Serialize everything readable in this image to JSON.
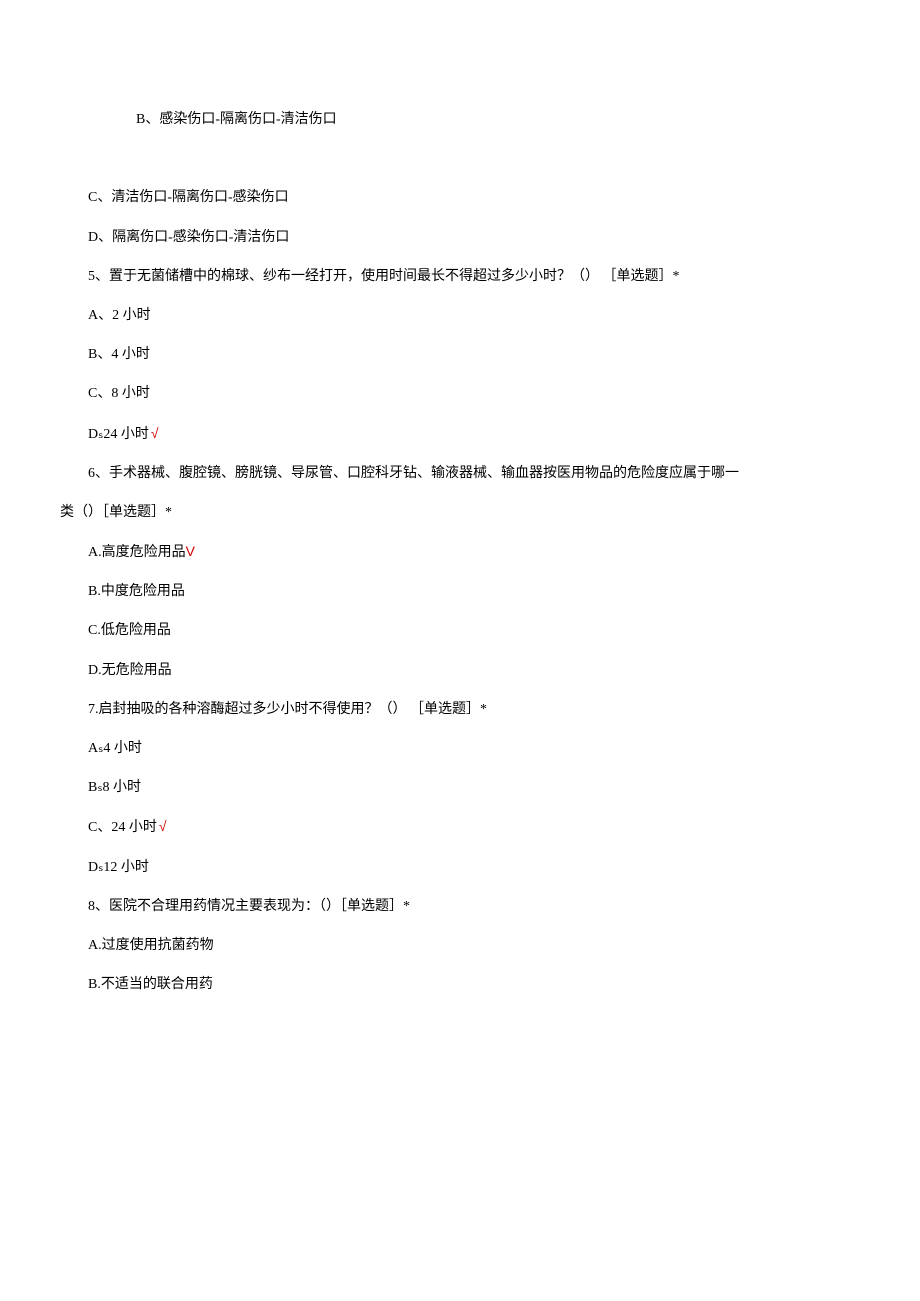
{
  "lines": {
    "l1": "B、感染伤口-隔离伤口-清洁伤口",
    "l2": "C、清洁伤口-隔离伤口-感染伤口",
    "l3": "D、隔离伤口-感染伤口-清洁伤口",
    "l4": "5、置于无菌储槽中的棉球、纱布一经打开，使用时间最长不得超过多少小时？（） ［单选题］*",
    "l5": "A、2 小时",
    "l6": "B、4 小时",
    "l7": "C、8 小时",
    "l8": "Dₛ24 小时",
    "l8check": "√",
    "l9": "6、手术器械、腹腔镜、膀胱镜、导尿管、口腔科牙钻、输液器械、输血器按医用物品的危险度应属于哪一",
    "l10": "类（）［单选题］*",
    "l11": "A.高度危险用品",
    "l11v": "V",
    "l12": "B.中度危险用品",
    "l13": "C.低危险用品",
    "l14": "D.无危险用品",
    "l15": "7.启封抽吸的各种溶酶超过多少小时不得使用？（） ［单选题］*",
    "l16": "Aₛ4 小时",
    "l17": "Bₛ8 小时",
    "l18": "C、24 小时",
    "l18check": "√",
    "l19": "Dₛ12 小时",
    "l20": "8、医院不合理用药情况主要表现为：（）［单选题］*",
    "l21": "A.过度使用抗菌药物",
    "l22": "B.不适当的联合用药"
  }
}
